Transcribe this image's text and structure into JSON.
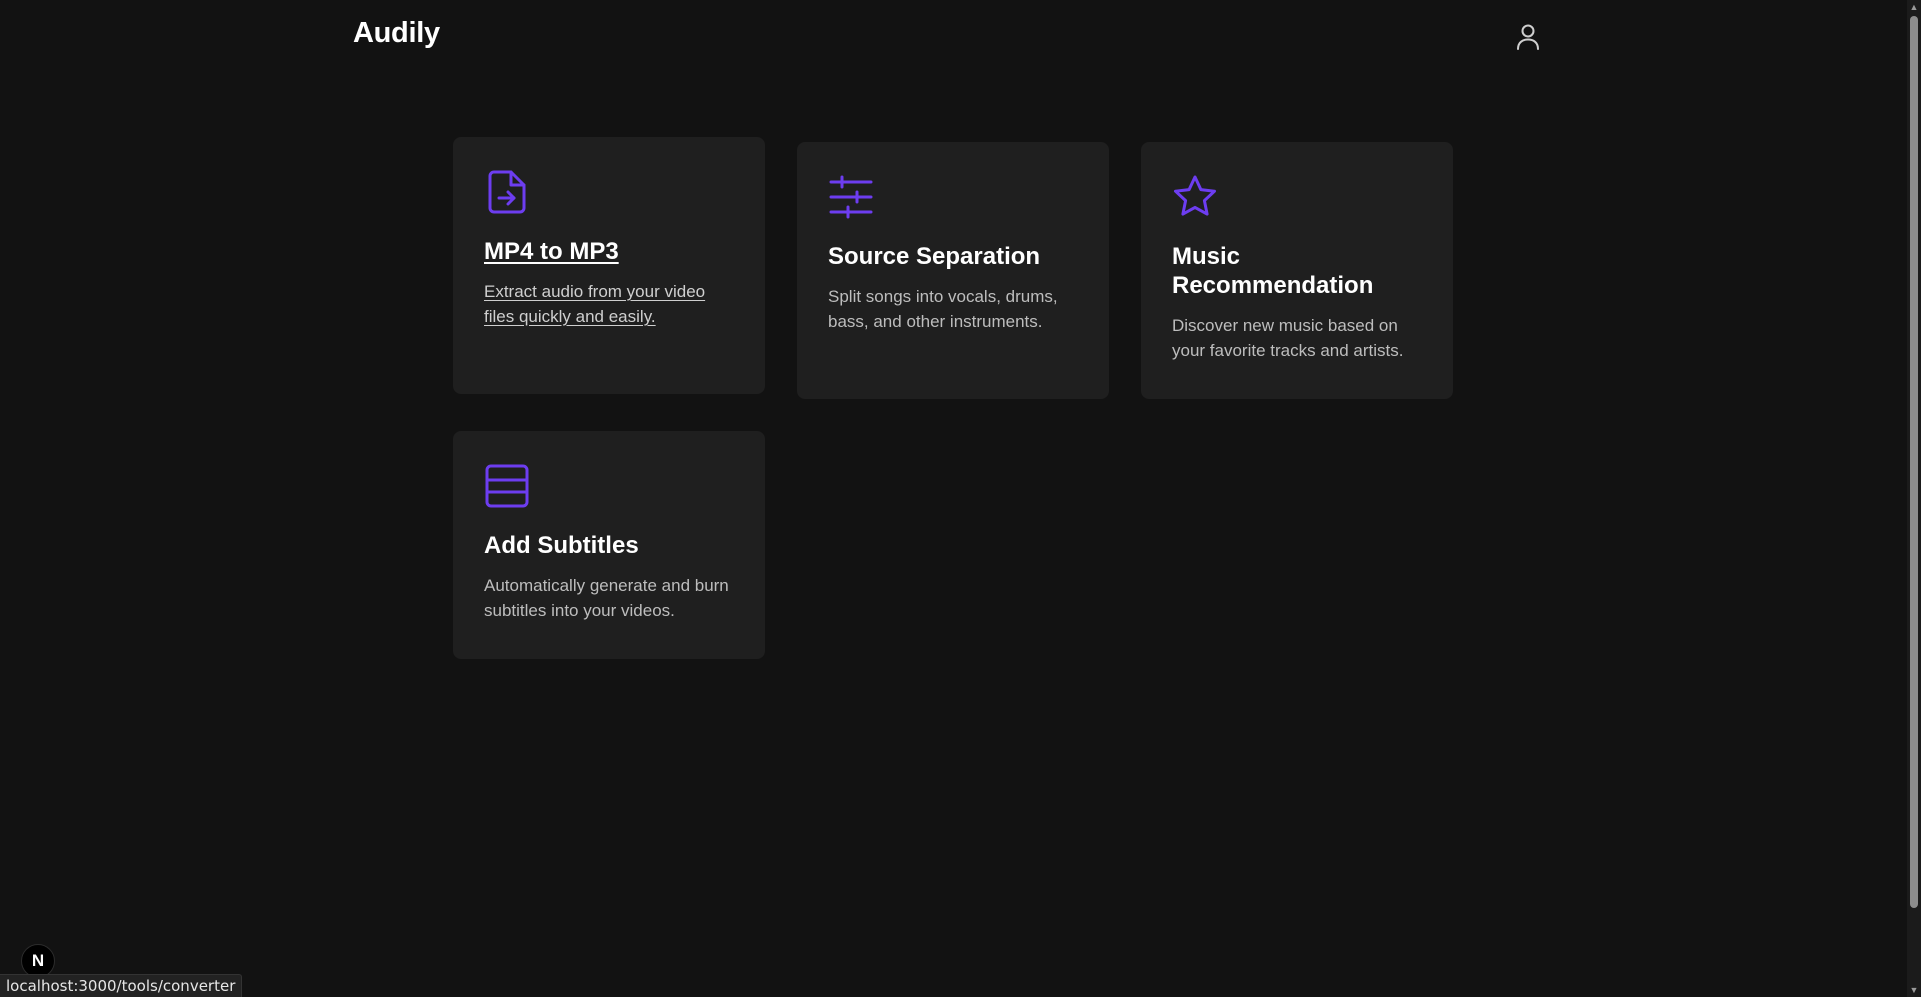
{
  "app": {
    "logo": "Audily"
  },
  "header": {
    "account_icon": "user-icon"
  },
  "colors": {
    "background": "#121212",
    "card": "#1f1f1f",
    "accent": "#6d3df0",
    "text_muted": "#bdbdbd"
  },
  "tools": [
    {
      "title": "MP4 to MP3",
      "description": "Extract audio from your video files quickly and easily.",
      "icon": "file-arrow-right-icon",
      "hovered": true
    },
    {
      "title": "Source Separation",
      "description": "Split songs into vocals, drums, bass, and other instruments.",
      "icon": "sliders-icon",
      "hovered": false
    },
    {
      "title": "Music Recommendation",
      "description": "Discover new music based on your favorite tracks and artists.",
      "icon": "star-icon",
      "hovered": false
    },
    {
      "title": "Add Subtitles",
      "description": "Automatically generate and burn subtitles into your videos.",
      "icon": "subtitles-icon",
      "hovered": false
    }
  ],
  "dev_badge": {
    "label": "N"
  },
  "status_bar": {
    "url": "localhost:3000/tools/converter"
  }
}
